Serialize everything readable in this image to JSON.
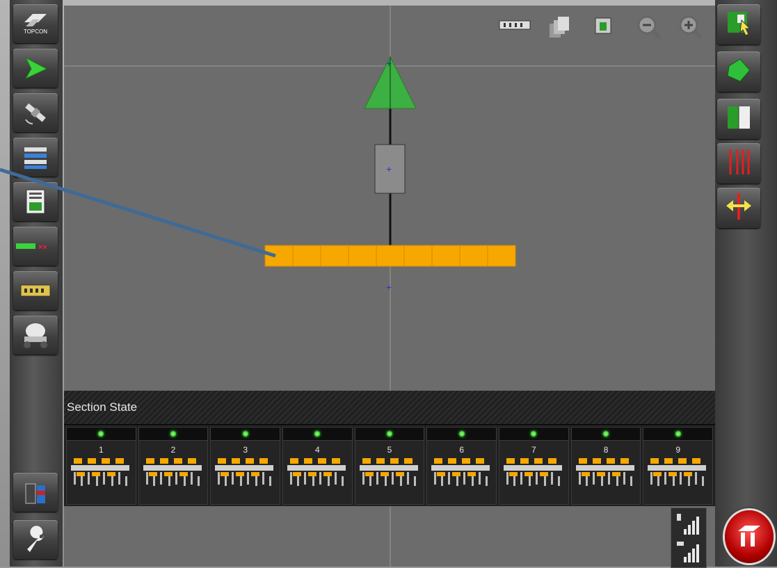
{
  "brand": {
    "logo_text": "TOPCON"
  },
  "left_toolbar": {
    "items": [
      {
        "name": "topcon-logo-button",
        "icon": "topcon-logo-icon"
      },
      {
        "name": "navigation-button",
        "icon": "green-arrow-icon"
      },
      {
        "name": "gps-button",
        "icon": "satellite-icon"
      },
      {
        "name": "layout-button",
        "icon": "bars-icon"
      },
      {
        "name": "report-button",
        "icon": "document-icon"
      },
      {
        "name": "section-control-button",
        "icon": "sections-icon"
      },
      {
        "name": "implement-button",
        "icon": "implement-icon"
      },
      {
        "name": "vehicle-button",
        "icon": "tank-icon"
      },
      {
        "name": "data-button",
        "icon": "cylinders-icon"
      },
      {
        "name": "settings-button",
        "icon": "wrench-icon"
      }
    ]
  },
  "top_toolbar": {
    "items": [
      {
        "name": "implement-view-button",
        "icon": "implement-mini-icon"
      },
      {
        "name": "layers-button",
        "icon": "layers-icon"
      },
      {
        "name": "grid-button",
        "icon": "grid-icon"
      },
      {
        "name": "zoom-out-button",
        "icon": "zoom-out-icon"
      },
      {
        "name": "zoom-in-button",
        "icon": "zoom-in-icon"
      }
    ]
  },
  "right_toolbar": {
    "items": [
      {
        "name": "field-select-button",
        "icon": "field-cursor-icon"
      },
      {
        "name": "boundary-button",
        "icon": "boundary-icon"
      },
      {
        "name": "guidance-button",
        "icon": "guidance-icon"
      },
      {
        "name": "lines-button",
        "icon": "red-lines-icon"
      },
      {
        "name": "shift-button",
        "icon": "shift-arrows-icon"
      }
    ]
  },
  "section_state": {
    "title": "Section State",
    "sections": [
      {
        "number": "1",
        "active": true
      },
      {
        "number": "2",
        "active": true
      },
      {
        "number": "3",
        "active": true
      },
      {
        "number": "4",
        "active": true
      },
      {
        "number": "5",
        "active": true
      },
      {
        "number": "6",
        "active": true
      },
      {
        "number": "7",
        "active": true
      },
      {
        "number": "8",
        "active": true
      },
      {
        "number": "9",
        "active": true
      }
    ]
  },
  "colors": {
    "section_orange": "#f6a800",
    "vehicle_green": "#3cb043",
    "led_green": "#22c322",
    "map_bg": "#6c6c6c",
    "callout_line": "#3f6a97"
  }
}
